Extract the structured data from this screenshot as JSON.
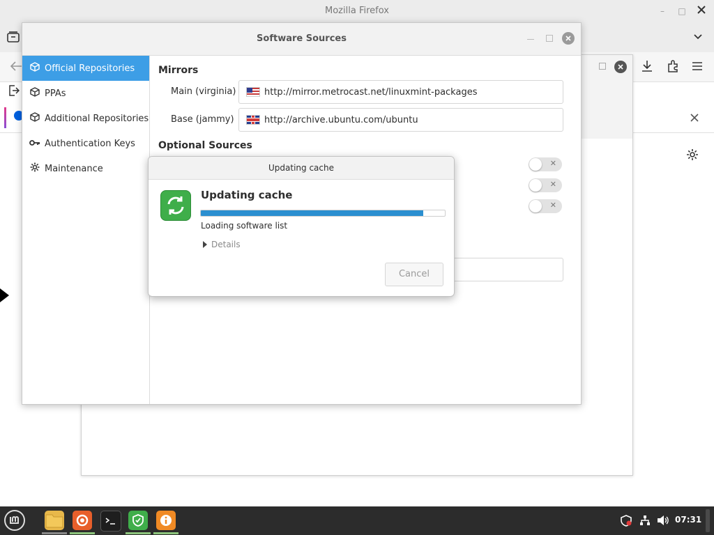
{
  "firefox": {
    "title": "Mozilla Firefox",
    "win_min": "–",
    "win_max": "□",
    "win_close": "✕"
  },
  "software_sources": {
    "title": "Software Sources",
    "sidebar": [
      {
        "label": "Official Repositories",
        "icon": "package-icon",
        "active": true
      },
      {
        "label": "PPAs",
        "icon": "package-icon",
        "active": false
      },
      {
        "label": "Additional Repositories",
        "icon": "package-icon",
        "active": false
      },
      {
        "label": "Authentication Keys",
        "icon": "key-icon",
        "active": false
      },
      {
        "label": "Maintenance",
        "icon": "gear-icon",
        "active": false
      }
    ],
    "mirrors_heading": "Mirrors",
    "mirrors": [
      {
        "label": "Main (virginia)",
        "url": "http://mirror.metrocast.net/linuxmint-packages",
        "flag": "us-flag-icon"
      },
      {
        "label": "Base (jammy)",
        "url": "http://archive.ubuntu.com/ubuntu",
        "flag": "uk-flag-icon"
      }
    ],
    "optional_heading": "Optional Sources",
    "toggles": [
      false,
      false,
      false
    ]
  },
  "updating_dialog": {
    "title": "Updating cache",
    "heading": "Updating cache",
    "progress": 0.91,
    "status": "Loading software list",
    "details": "Details",
    "cancel": "Cancel"
  },
  "taskbar": {
    "apps": [
      "files-icon",
      "firefox-icon",
      "terminal-icon",
      "update-manager-icon",
      "info-icon"
    ],
    "clock": "07:31",
    "accent": "#8cc47c"
  },
  "colors": {
    "selection": "#3d9ee6",
    "progress": "#2b8fd0",
    "refresh_icon": "#3fae4a"
  }
}
